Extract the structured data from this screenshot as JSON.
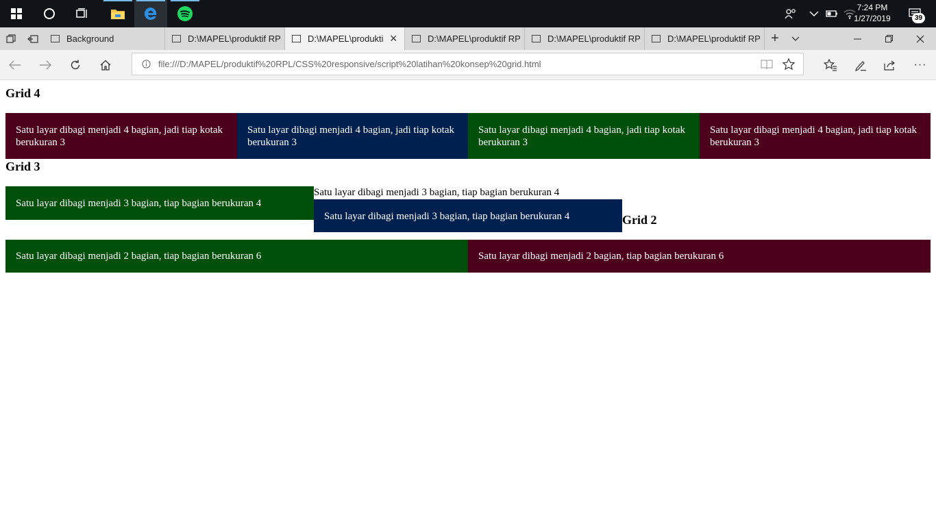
{
  "taskbar": {
    "clock_time": "7:24 PM",
    "clock_date": "1/27/2019",
    "notification_count": "39",
    "icons": [
      "windows-start-icon",
      "cortana-circle-icon",
      "task-view-icon",
      "file-explorer-icon",
      "edge-icon",
      "spotify-icon"
    ],
    "tray_icons": [
      "people-icon",
      "chevron-up-icon",
      "battery-icon",
      "wifi-icon",
      "notification-center-icon"
    ]
  },
  "browser": {
    "tabs": [
      {
        "title": "Background"
      },
      {
        "title": "D:\\MAPEL\\produktif RP"
      },
      {
        "title": "D:\\MAPEL\\produkti"
      },
      {
        "title": "D:\\MAPEL\\produktif RP"
      },
      {
        "title": "D:\\MAPEL\\produktif RP"
      },
      {
        "title": "D:\\MAPEL\\produktif RP"
      }
    ],
    "active_tab_index": 2,
    "url": "file:///D:/MAPEL/produktif%20RPL/CSS%20responsive/script%20latihan%20konsep%20grid.html"
  },
  "page": {
    "grid4_heading": "Grid 4",
    "grid4_boxes": [
      "Satu layar dibagi menjadi 4 bagian, jadi tiap kotak berukuran 3",
      "Satu layar dibagi menjadi 4 bagian, jadi tiap kotak berukuran 3",
      "Satu layar dibagi menjadi 4 bagian, jadi tiap kotak berukuran 3",
      "Satu layar dibagi menjadi 4 bagian, jadi tiap kotak berukuran 3"
    ],
    "grid3_heading": "Grid 3",
    "grid3_box1": "Satu layar dibagi menjadi 3 bagian, tiap bagian berukuran 4",
    "grid3_plain": "Satu layar dibagi menjadi 3 bagian, tiap bagian berukuran 4",
    "grid3_box2": "Satu layar dibagi menjadi 3 bagian, tiap bagian berukuran 4",
    "grid2_heading": "Grid 2",
    "grid2_boxes": [
      "Satu layar dibagi menjadi 2 bagian, tiap bagian berukuran 6",
      "Satu layar dibagi menjadi 2 bagian, tiap bagian berukuran 6"
    ],
    "colors": {
      "maroon": "#4d001c",
      "navy": "#00204f",
      "green": "#004f0a"
    }
  }
}
